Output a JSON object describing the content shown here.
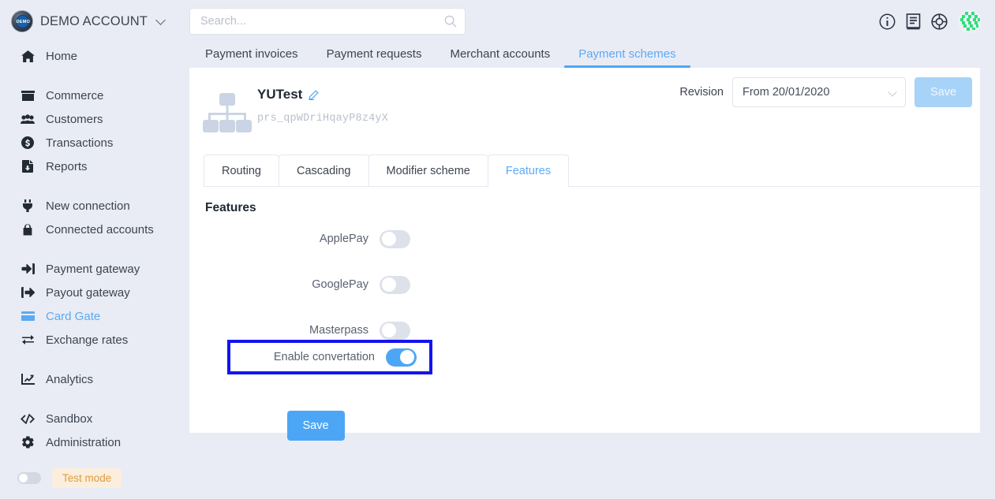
{
  "sidebar": {
    "brand": {
      "name": "DEMO ACCOUNT",
      "logo_text": "DEMO"
    },
    "items": [
      {
        "label": "Home",
        "icon": "home-icon",
        "active": false
      },
      {
        "label": "Commerce",
        "icon": "store-icon",
        "active": false
      },
      {
        "label": "Customers",
        "icon": "users-icon",
        "active": false
      },
      {
        "label": "Transactions",
        "icon": "coin-icon",
        "active": false
      },
      {
        "label": "Reports",
        "icon": "report-file-icon",
        "active": false
      },
      {
        "label": "New connection",
        "icon": "plug-icon",
        "active": false
      },
      {
        "label": "Connected accounts",
        "icon": "lock-icon",
        "active": false
      },
      {
        "label": "Payment gateway",
        "icon": "sign-in-icon",
        "active": false
      },
      {
        "label": "Payout gateway",
        "icon": "sign-out-icon",
        "active": false
      },
      {
        "label": "Card Gate",
        "icon": "credit-card-icon",
        "active": true
      },
      {
        "label": "Exchange rates",
        "icon": "exchange-icon",
        "active": false
      },
      {
        "label": "Analytics",
        "icon": "chart-line-icon",
        "active": false
      },
      {
        "label": "Sandbox",
        "icon": "code-icon",
        "active": false
      },
      {
        "label": "Administration",
        "icon": "gear-icon",
        "active": false
      }
    ],
    "test_mode": {
      "label": "Test mode",
      "enabled": false
    }
  },
  "topbar": {
    "search": {
      "value": "",
      "placeholder": "Search..."
    },
    "icons": [
      "info-circle-icon",
      "book-icon",
      "lifebuoy-icon"
    ]
  },
  "main_tabs": [
    {
      "label": "Payment invoices",
      "active": false
    },
    {
      "label": "Payment requests",
      "active": false
    },
    {
      "label": "Merchant accounts",
      "active": false
    },
    {
      "label": "Payment schemes",
      "active": true
    }
  ],
  "scheme": {
    "name": "YUTest",
    "id": "prs_qpWDriHqayP8z4yX",
    "revision_label": "Revision",
    "revision_value": "From 20/01/2020",
    "save_top_label": "Save"
  },
  "inner_tabs": [
    {
      "label": "Routing",
      "active": false
    },
    {
      "label": "Cascading",
      "active": false
    },
    {
      "label": "Modifier scheme",
      "active": false
    },
    {
      "label": "Features",
      "active": true
    }
  ],
  "features": {
    "title": "Features",
    "rows": [
      {
        "label": "ApplePay",
        "enabled": false
      },
      {
        "label": "GooglePay",
        "enabled": false
      },
      {
        "label": "Masterpass",
        "enabled": false
      }
    ],
    "highlighted": {
      "label": "Enable convertation",
      "enabled": true
    },
    "save_label": "Save"
  },
  "colors": {
    "accent": "#4da6f5",
    "active_link": "#5aaaf5",
    "page_bg": "#e9ecf5",
    "highlight_border": "#1414f0",
    "test_mode_text": "#e09b3d",
    "test_mode_bg": "#fbeedd"
  }
}
